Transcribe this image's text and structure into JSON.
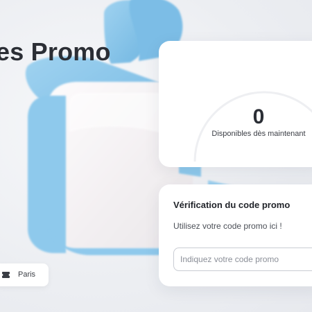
{
  "hero": {
    "title": "es Promo"
  },
  "location": {
    "city": "Paris",
    "icon": "ticket-icon"
  },
  "counter": {
    "value": "0",
    "label": "Disponibles dès maintenant"
  },
  "verification": {
    "title": "Vérification du code promo",
    "description": "Utilisez votre code promo ici !",
    "input_value": "",
    "input_placeholder": "Indiquez votre code promo"
  },
  "colors": {
    "gift_ribbon": "#86c3e8",
    "gift_box": "#f7f4f6",
    "text_dark": "#2b2e35",
    "card_bg": "#ffffff"
  }
}
